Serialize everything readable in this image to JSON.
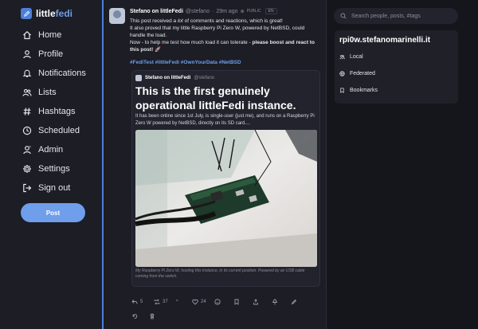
{
  "brand": {
    "name_part1": "little",
    "name_part2": "fedi"
  },
  "nav": {
    "items": [
      {
        "label": "Home",
        "icon": "home-icon"
      },
      {
        "label": "Profile",
        "icon": "user-icon"
      },
      {
        "label": "Notifications",
        "icon": "bell-icon"
      },
      {
        "label": "Lists",
        "icon": "users-icon"
      },
      {
        "label": "Hashtags",
        "icon": "hash-icon"
      },
      {
        "label": "Scheduled",
        "icon": "clock-icon"
      },
      {
        "label": "Admin",
        "icon": "shield-icon"
      },
      {
        "label": "Settings",
        "icon": "gear-icon"
      },
      {
        "label": "Sign out",
        "icon": "signout-icon"
      }
    ],
    "post_button": "Post"
  },
  "post": {
    "author": "Stefano on littleFedi",
    "handle": "@stefano",
    "time": "29m ago",
    "visibility": "PUBLIC",
    "language": "EN",
    "body_line1_pre": "This post received a ",
    "body_line1_em": "lot",
    "body_line1_post": " of comments and reactions, which is great!",
    "body_line2": "It also proved that my little Raspberry Pi Zero W, powered by NetBSD, could handle the load.",
    "body_line3_pre": "Now - to help me test how much load it can tolerate - ",
    "body_line3_bold": "please boost and react to this post!",
    "body_line3_emoji": "🚀",
    "tags": "#FediTest #littleFedi #OwnYourData #NetBSD",
    "quote": {
      "author": "Stefano on littleFedi",
      "handle": "@stefano",
      "title": "This is the first genuinely operational littleFedi instance.",
      "description": "It has been online since 1st July, is single-user (just me), and runs on a Raspberry Pi Zero W powered by NetBSD, directly on its SD card....",
      "image_caption": "My Raspberry Pi Zero W, hosting this instance, in its current position. Powered by an USB cable coming from the switch."
    },
    "actions": {
      "replies": "5",
      "boosts": "37",
      "reactions": "24"
    }
  },
  "right": {
    "search_placeholder": "Search people, posts, #tags",
    "instance": "rpi0w.stefanomarinelli.it",
    "timelines": [
      {
        "label": "Local",
        "icon": "users-icon"
      },
      {
        "label": "Federated",
        "icon": "globe-icon"
      },
      {
        "label": "Bookmarks",
        "icon": "bookmark-icon"
      }
    ]
  },
  "colors": {
    "accent": "#6f9eea",
    "bg": "#1c1d25",
    "panel": "#15161c"
  }
}
